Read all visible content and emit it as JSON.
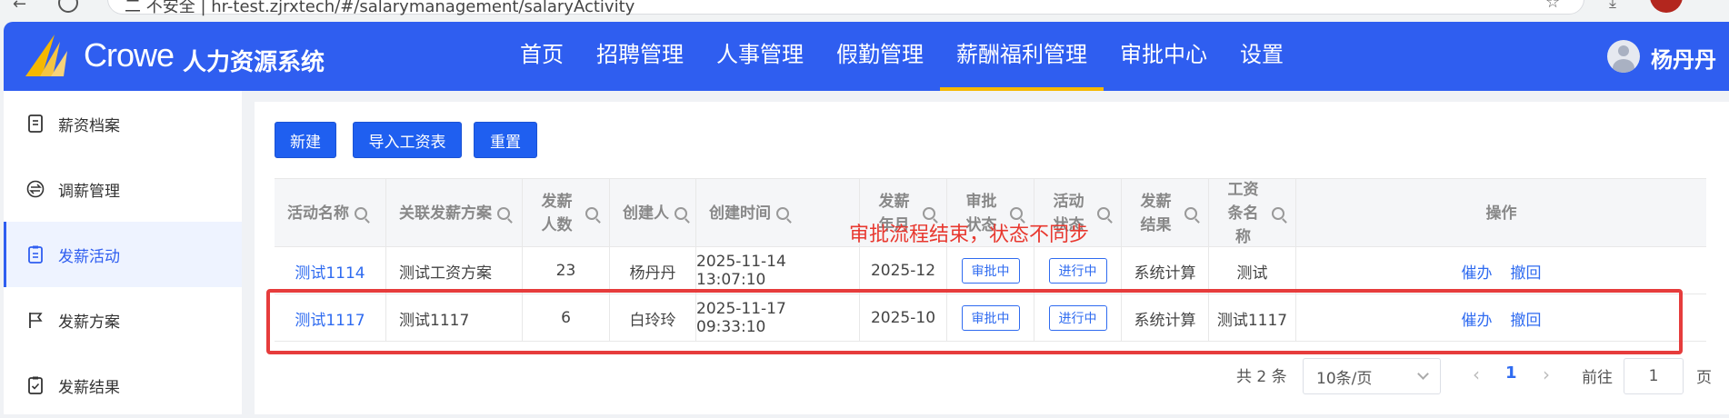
{
  "browser": {
    "url": "二 不安全 | hr-test.zjrxtech/#/salarymanagement/salaryActivity"
  },
  "header": {
    "brand": "Crowe",
    "system_name": "人力资源系统",
    "nav": [
      "首页",
      "招聘管理",
      "人事管理",
      "假勤管理",
      "薪酬福利管理",
      "审批中心",
      "设置"
    ],
    "active_nav": "薪酬福利管理",
    "user_name": "杨丹丹"
  },
  "sidebar": {
    "items": [
      {
        "label": "薪资档案",
        "icon": "file-icon"
      },
      {
        "label": "调薪管理",
        "icon": "exchange-icon"
      },
      {
        "label": "发薪活动",
        "icon": "clipboard-icon"
      },
      {
        "label": "发薪方案",
        "icon": "flag-icon"
      },
      {
        "label": "发薪结果",
        "icon": "check-clipboard-icon"
      }
    ],
    "active": "发薪活动"
  },
  "toolbar": {
    "new_label": "新建",
    "import_label": "导入工资表",
    "reset_label": "重置"
  },
  "table": {
    "columns": [
      {
        "label": "活动名称",
        "searchable": true
      },
      {
        "label": "关联发薪方案",
        "searchable": true
      },
      {
        "label": "发薪人数",
        "searchable": true
      },
      {
        "label": "创建人",
        "searchable": true
      },
      {
        "label": "创建时间",
        "searchable": true
      },
      {
        "label": "发薪年月",
        "searchable": true
      },
      {
        "label": "审批状态",
        "searchable": true
      },
      {
        "label": "活动状态",
        "searchable": true
      },
      {
        "label": "发薪结果",
        "searchable": true
      },
      {
        "label": "工资条名称",
        "searchable": true
      },
      {
        "label": "操作",
        "searchable": false
      }
    ],
    "rows": [
      {
        "name": "测试1114",
        "plan": "测试工资方案",
        "count": "23",
        "creator": "杨丹丹",
        "created": "2025-11-14 13:07:10",
        "period": "2025-12",
        "approval": "审批中",
        "status": "进行中",
        "result": "系统计算",
        "payslip": "测试",
        "actions": [
          "催办",
          "撤回"
        ]
      },
      {
        "name": "测试1117",
        "plan": "测试1117",
        "count": "6",
        "creator": "白玲玲",
        "created": "2025-11-17 09:33:10",
        "period": "2025-10",
        "approval": "审批中",
        "status": "进行中",
        "result": "系统计算",
        "payslip": "测试1117",
        "actions": [
          "催办",
          "撤回"
        ]
      }
    ]
  },
  "annotation": {
    "text": "审批流程结束，状态不同步",
    "color": "#e8382f"
  },
  "pagination": {
    "total_text": "共 2 条",
    "page_size": "10条/页",
    "current_page": "1",
    "goto_label": "前往",
    "goto_value": "1",
    "goto_suffix": "页"
  },
  "colors": {
    "brand": "#2f5ef0",
    "active_underline": "#f5b800",
    "link": "#2f6bf0",
    "highlight": "#e63c3c"
  }
}
